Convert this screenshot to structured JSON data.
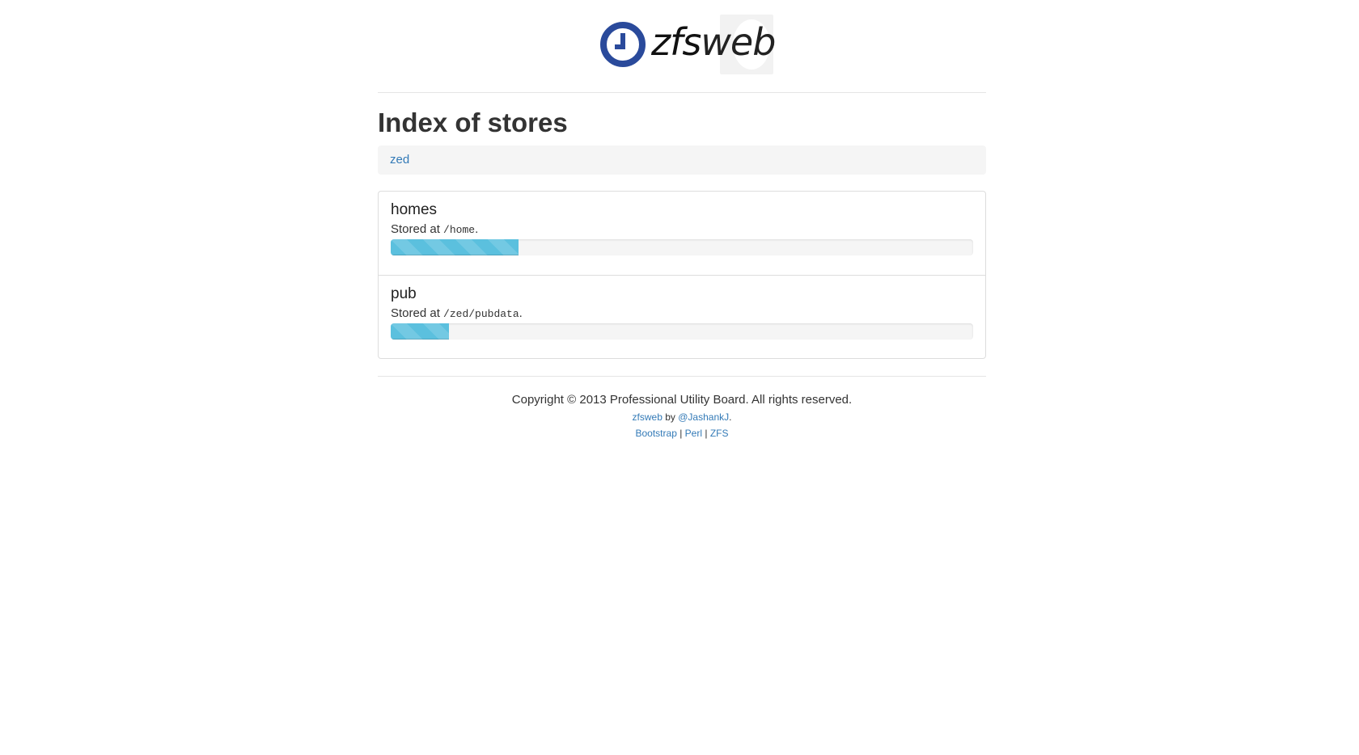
{
  "logo": {
    "text_zfs": "zfs",
    "text_web": "web",
    "brand_color": "#2a4a9b"
  },
  "header": {
    "title": "Index of stores"
  },
  "breadcrumb": {
    "items": [
      "zed"
    ]
  },
  "stores": [
    {
      "name": "homes",
      "path_prefix": "Stored at ",
      "path": "/home",
      "path_suffix": ".",
      "usage_fraction": 0.22
    },
    {
      "name": "pub",
      "path_prefix": "Stored at ",
      "path": "/zed/pubdata",
      "path_suffix": ".",
      "usage_fraction": 0.1
    }
  ],
  "footer": {
    "copyright": "Copyright © 2013 Professional Utility Board. All rights reserved.",
    "credit_link": "zfsweb",
    "credit_by": " by ",
    "author_link": "@JashankJ",
    "author_suffix": ".",
    "tech_links": [
      "Bootstrap",
      "Perl",
      "ZFS"
    ],
    "separator": " | "
  },
  "colors": {
    "link": "#337ab7",
    "progress": "#5bc0de"
  }
}
